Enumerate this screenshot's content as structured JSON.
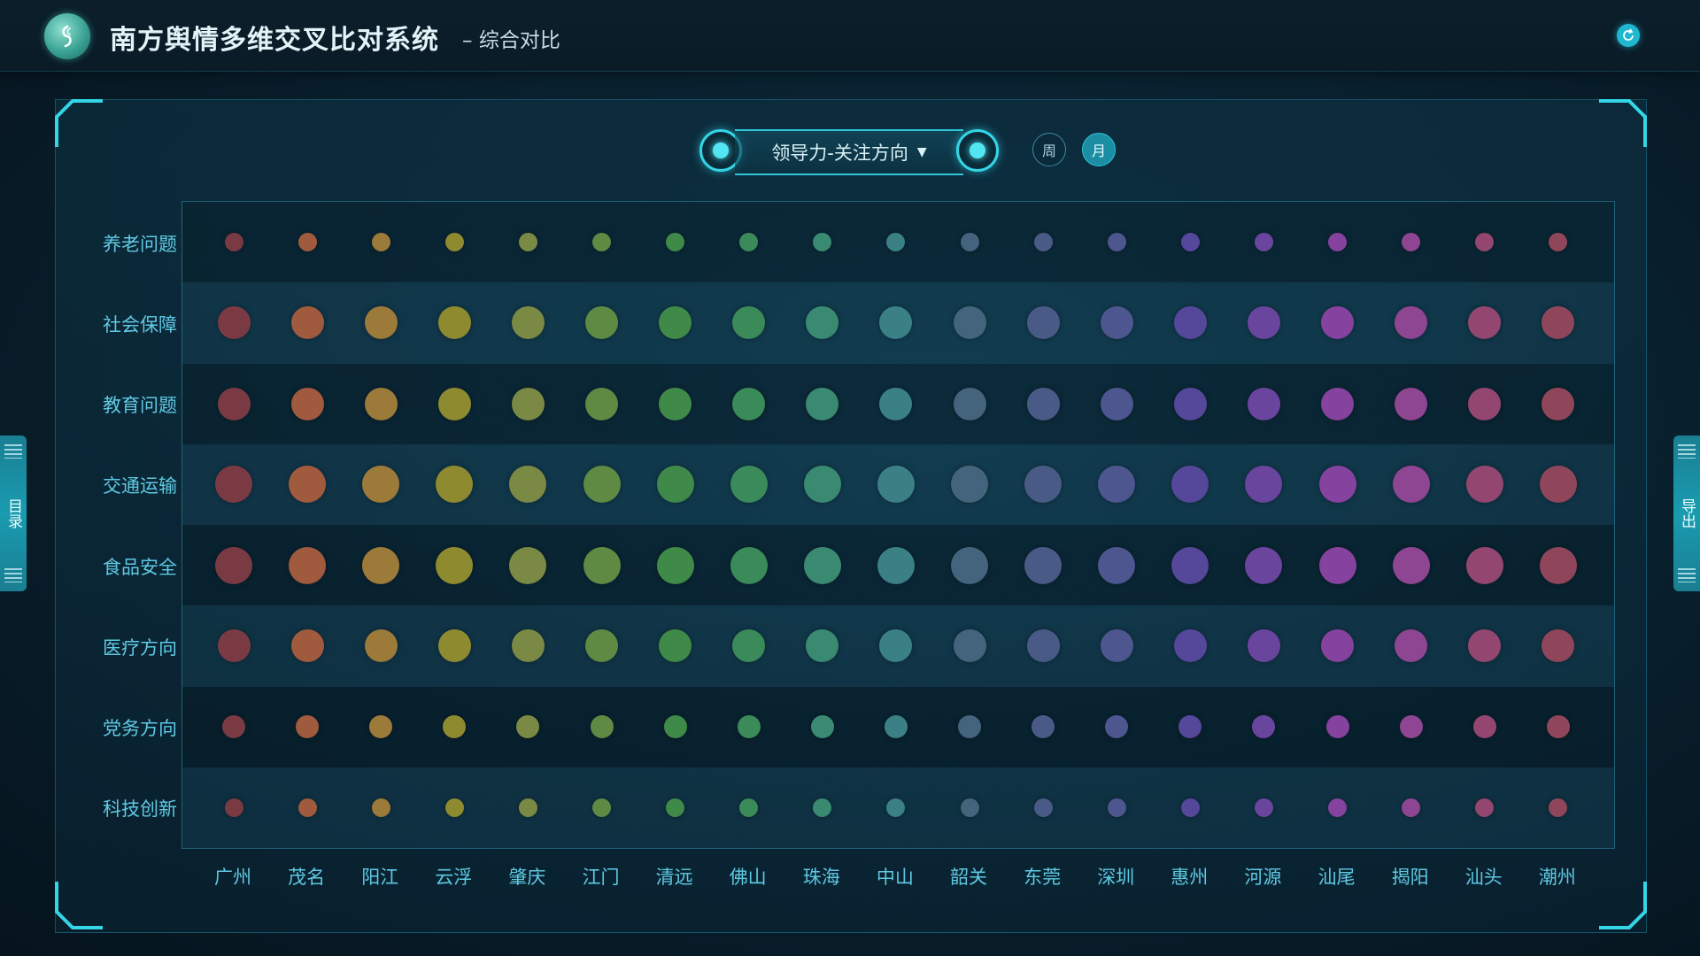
{
  "header": {
    "title": "南方舆情多维交叉比对系统",
    "separator": "–",
    "subtitle": "综合对比"
  },
  "selector": {
    "label": "领导力-关注方向",
    "arrow": "▼"
  },
  "period": {
    "week": "周",
    "month": "月",
    "selected": "月"
  },
  "side_tabs": {
    "left": "目录",
    "right": "导出"
  },
  "icons": [
    "logo-icon",
    "refresh-icon",
    "dropdown-arrow-icon",
    "menu-lines-icon"
  ],
  "colors": {
    "accent": "#34d5e6",
    "label": "#5fc9e3",
    "frame": "#2fc6d8"
  },
  "chart_data": {
    "type": "bubble",
    "rows": [
      "养老问题",
      "社会保障",
      "教育问题",
      "交通运输",
      "食品安全",
      "医疗方向",
      "党务方向",
      "科技创新"
    ],
    "columns": [
      "广州",
      "茂名",
      "阳江",
      "云浮",
      "肇庆",
      "江门",
      "清远",
      "佛山",
      "珠海",
      "中山",
      "韶关",
      "东莞",
      "深圳",
      "惠州",
      "河源",
      "汕尾",
      "揭阳",
      "汕头",
      "潮州"
    ],
    "row_sizes": [
      2,
      4,
      4,
      5,
      5,
      4,
      3,
      2
    ],
    "column_colors": [
      "#7a3a44",
      "#a05a3e",
      "#9c7a3a",
      "#8e8a30",
      "#7a8a44",
      "#5e8a44",
      "#3f8a48",
      "#3a8a5a",
      "#3a8a72",
      "#3a8084",
      "#44647e",
      "#4a5a86",
      "#4d568f",
      "#55479a",
      "#6a459e",
      "#85429e",
      "#8e4592",
      "#934670",
      "#90465a"
    ]
  }
}
